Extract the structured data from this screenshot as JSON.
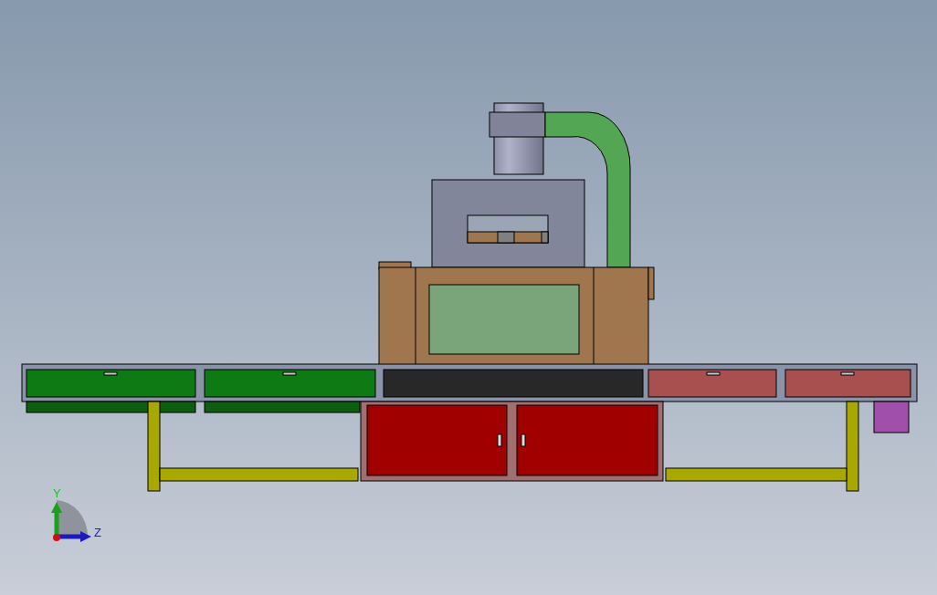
{
  "viewport": {
    "triad": {
      "axes": [
        {
          "kind": "y",
          "label": "Y"
        },
        {
          "kind": "z",
          "label": "Z"
        }
      ]
    }
  }
}
